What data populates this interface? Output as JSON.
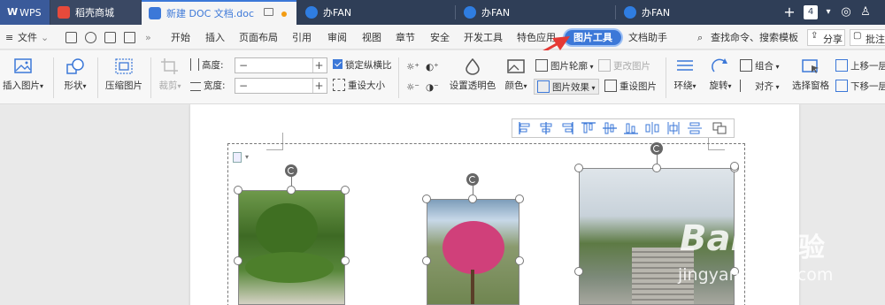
{
  "tabs": [
    {
      "label": "WPS"
    },
    {
      "label": "稻壳商城"
    },
    {
      "label": "新建 DOC 文档.doc"
    },
    {
      "label": "办FAN"
    },
    {
      "label": "办FAN"
    },
    {
      "label": "办FAN"
    }
  ],
  "tabbar": {
    "badge": "4"
  },
  "menu": {
    "file": "文件",
    "items": [
      "开始",
      "插入",
      "页面布局",
      "引用",
      "审阅",
      "视图",
      "章节",
      "安全",
      "开发工具",
      "特色应用",
      "图片工具",
      "文档助手"
    ],
    "selected": "图片工具",
    "search": "查找命令、搜索模板",
    "share": "分享",
    "annotate": "批注"
  },
  "ribbon": {
    "insert_picture": "插入图片",
    "shape": "形状",
    "compress": "压缩图片",
    "crop": "裁剪",
    "height_label": "高度:",
    "width_label": "宽度:",
    "lock_ratio": "锁定纵横比",
    "reset_size": "重设大小",
    "set_transparent": "设置透明色",
    "color": "颜色",
    "picture_outline": "图片轮廓",
    "change_picture": "更改图片",
    "picture_effect": "图片效果",
    "reset_picture": "重设图片",
    "wrap": "环绕",
    "rotate": "旋转",
    "group": "组合",
    "align": "对齐",
    "selection_pane": "选择窗格",
    "bring_forward": "上移一层",
    "send_backward": "下移一层"
  },
  "watermark": {
    "brand": "Bai",
    "brand_cn": "经验",
    "url": "jingyan.baidu.com"
  },
  "colors": {
    "accent": "#3c78d8",
    "tabbar_bg": "#2f3e57",
    "arrow": "#e53935"
  }
}
